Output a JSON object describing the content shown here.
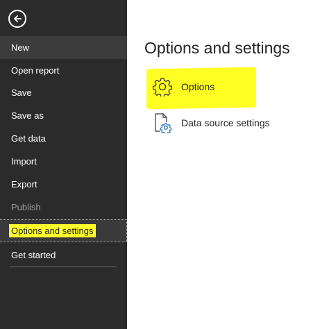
{
  "sidebar": {
    "back_icon": "back-arrow-circle-icon",
    "items": [
      {
        "label": "New"
      },
      {
        "label": "Open report"
      },
      {
        "label": "Save"
      },
      {
        "label": "Save as"
      },
      {
        "label": "Get data"
      },
      {
        "label": "Import"
      },
      {
        "label": "Export"
      },
      {
        "label": "Publish"
      },
      {
        "label": "Options and settings"
      },
      {
        "label": "Get started"
      }
    ],
    "highlight_color": "#ffff2a",
    "background": "#2b2b2b"
  },
  "main": {
    "title": "Options and settings",
    "options": [
      {
        "label": "Options",
        "icon": "gear-icon"
      },
      {
        "label": "Data source settings",
        "icon": "document-gear-icon"
      }
    ]
  }
}
